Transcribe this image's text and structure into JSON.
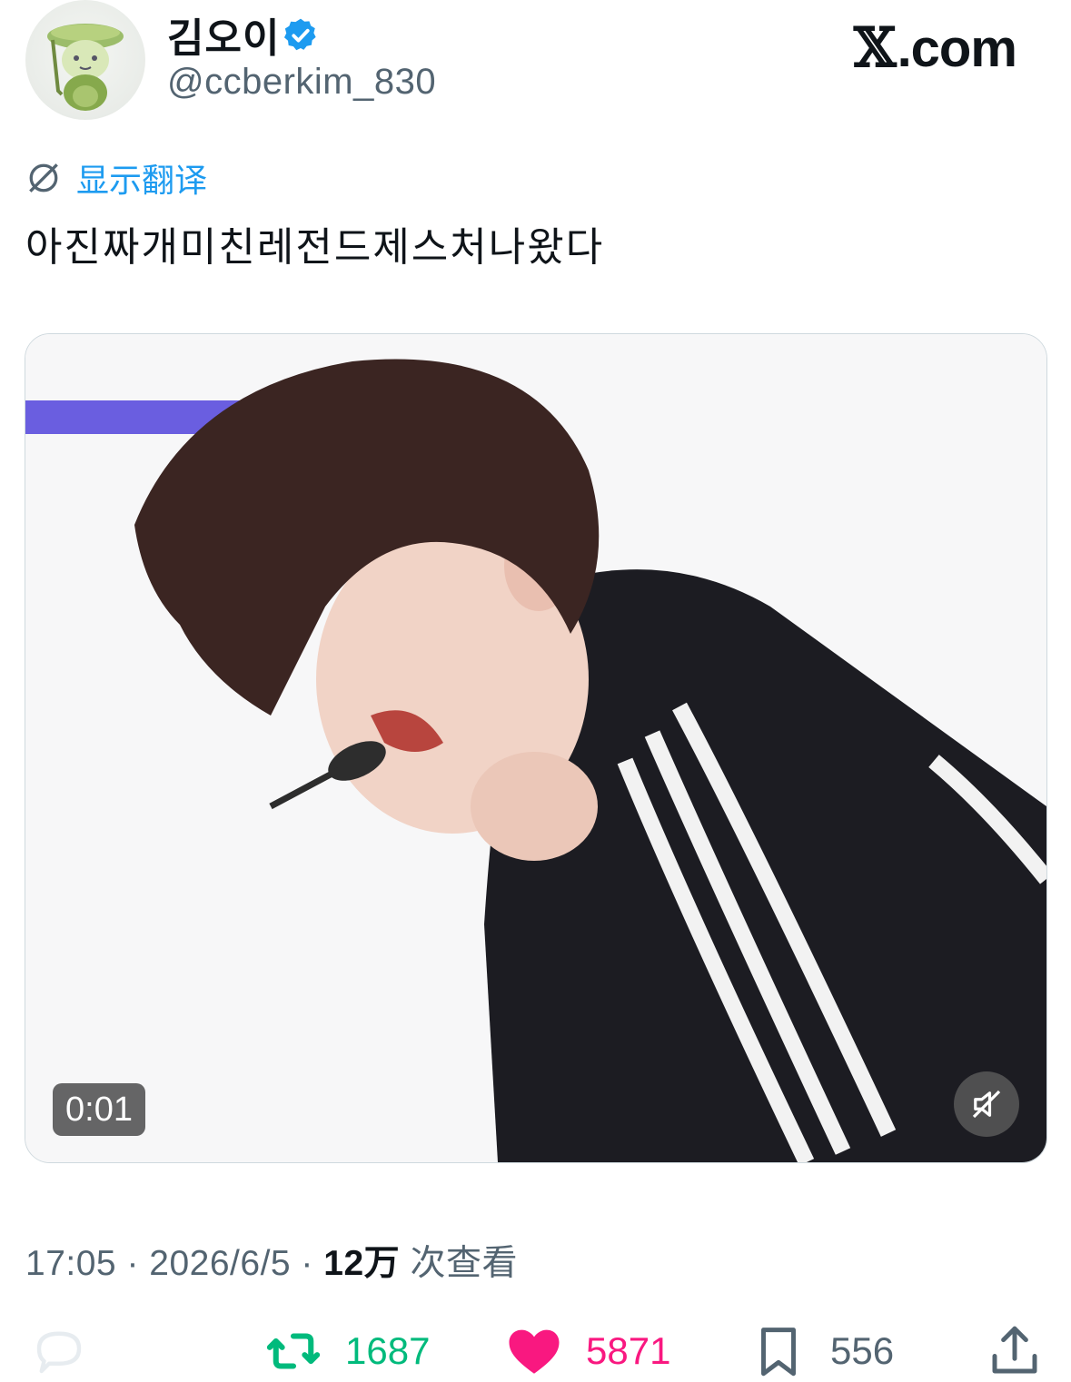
{
  "header": {
    "display_name": "김오이",
    "handle": "@ccberkim_830",
    "verified_icon": "verified-badge-icon",
    "brand": {
      "x": "𝕏",
      "suffix": ".com"
    }
  },
  "post": {
    "translate_label": "显示翻译",
    "text": "아진짜개미친레전드제스처나왔다"
  },
  "media": {
    "type": "video",
    "time": "0:01",
    "muted": true
  },
  "meta": {
    "time": "17:05",
    "separator": " · ",
    "date": "2026/6/5",
    "views_count": "12万",
    "views_label": " 次查看"
  },
  "actions": {
    "replies": "",
    "retweets": "1687",
    "likes": "5871",
    "bookmarks": "556"
  },
  "colors": {
    "accent": "#1d9bf0",
    "retweet": "#00ba7c",
    "like": "#f91880",
    "secondary_text": "#536471"
  }
}
